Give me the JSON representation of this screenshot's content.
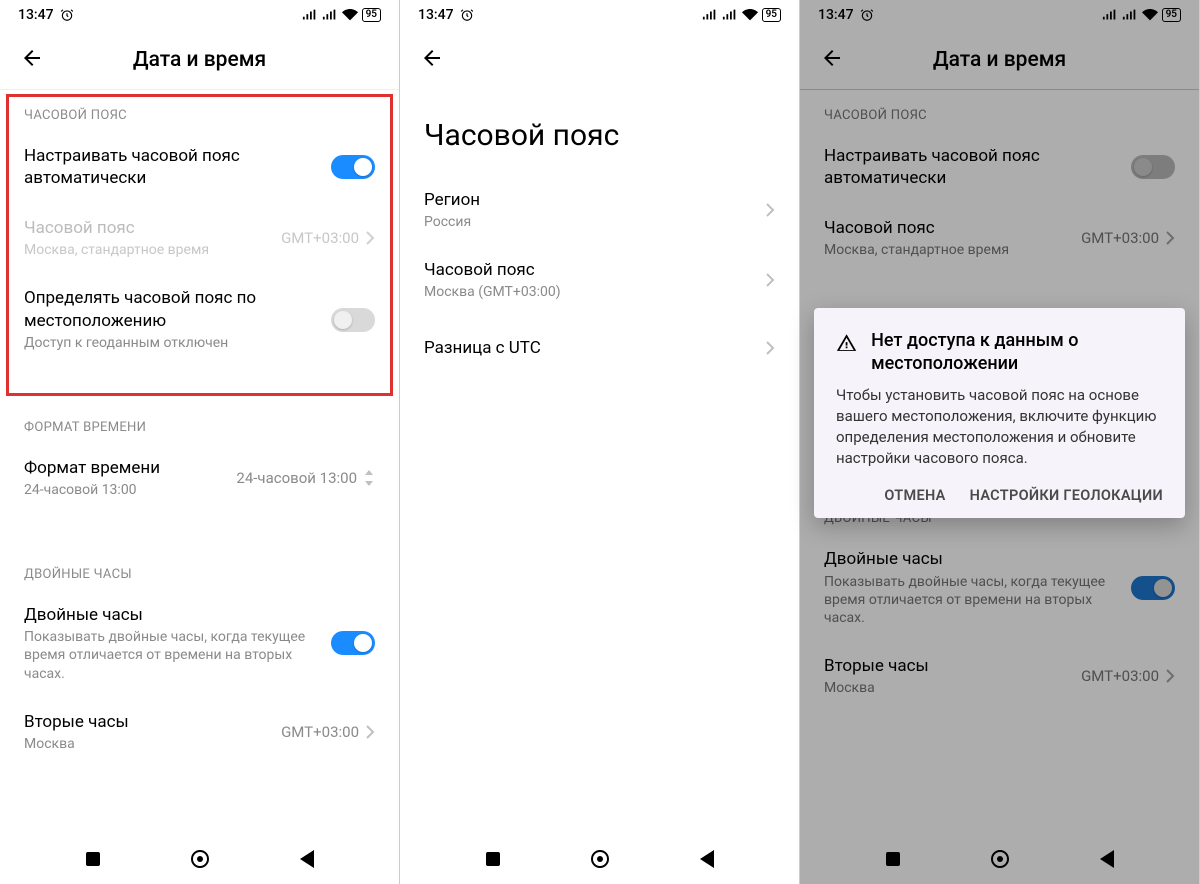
{
  "status": {
    "time": "13:47",
    "battery": "95"
  },
  "screen1": {
    "title": "Дата и время",
    "sections": {
      "tz_label": "ЧАСОВОЙ ПОЯС",
      "auto_tz": "Настраивать часовой пояс автоматически",
      "tz_title": "Часовой пояс",
      "tz_sub": "Москва, стандартное время",
      "tz_value": "GMT+03:00",
      "geo_title": "Определять часовой пояс по местоположению",
      "geo_sub": "Доступ к геоданным отключен",
      "fmt_label": "ФОРМАТ ВРЕМЕНИ",
      "fmt_title": "Формат времени",
      "fmt_sub": "24-часовой 13:00",
      "fmt_value": "24-часовой 13:00",
      "dual_label": "ДВОЙНЫЕ ЧАСЫ",
      "dual_title": "Двойные часы",
      "dual_sub": "Показывать двойные часы, когда текущее время отличается от времени на вторых часах.",
      "second_title": "Вторые часы",
      "second_sub": "Москва",
      "second_value": "GMT+03:00"
    }
  },
  "screen2": {
    "title": "Часовой пояс",
    "region_title": "Регион",
    "region_sub": "Россия",
    "tz_title": "Часовой пояс",
    "tz_sub": "Москва (GMT+03:00)",
    "utc_title": "Разница с UTC"
  },
  "screen3": {
    "title": "Дата и время",
    "dialog_title": "Нет доступа к данным о местоположении",
    "dialog_body": "Чтобы установить часовой пояс на основе вашего местоположения, включите функцию определения местоположения и обновите настройки часового пояса.",
    "cancel": "ОТМЕНА",
    "settings": "НАСТРОЙКИ ГЕОЛОКАЦИИ"
  }
}
